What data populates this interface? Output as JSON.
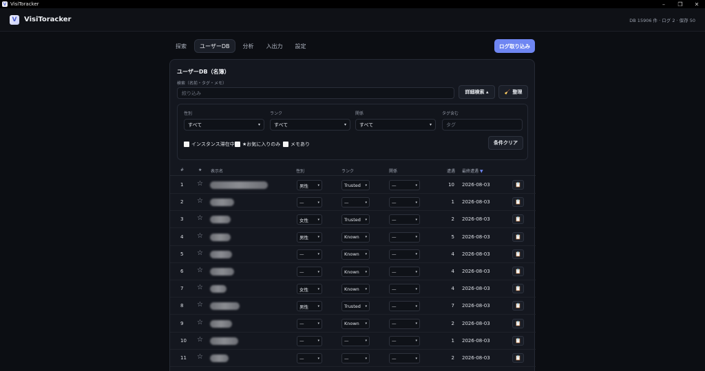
{
  "window": {
    "title": "VisiToracker",
    "controls": [
      "–",
      "❐",
      "✕"
    ]
  },
  "header": {
    "logo_letter": "V",
    "brand": "VisiToracker",
    "stats": "DB 15906 件 · ログ 2 · 保存 50"
  },
  "nav": {
    "tabs": [
      {
        "label": "探索",
        "active": false
      },
      {
        "label": "ユーザーDB",
        "active": true
      },
      {
        "label": "分析",
        "active": false
      },
      {
        "label": "入出力",
        "active": false
      },
      {
        "label": "設定",
        "active": false
      }
    ],
    "import_label": "ログ取り込み"
  },
  "panel": {
    "title": "ユーザーDB（名簿）",
    "search_label": "検索（名前・タグ・メモ）",
    "search_placeholder": "絞り込み",
    "search_value": "",
    "advanced_label": "詳細検索 ▴",
    "tidy_label": "整理",
    "filters": {
      "gender": {
        "label": "性別",
        "value": "すべて"
      },
      "rank": {
        "label": "ランク",
        "value": "すべて"
      },
      "relation": {
        "label": "関係",
        "value": "すべて"
      },
      "tag": {
        "label": "タグ含む",
        "placeholder": "タグ"
      },
      "checks": [
        {
          "label": "インスタンス滞在中",
          "checked": false
        },
        {
          "label": "★お気に入りのみ",
          "checked": false
        },
        {
          "label": "メモあり",
          "checked": false
        }
      ],
      "clear_label": "条件クリア"
    },
    "table": {
      "headers": {
        "index": "#",
        "star": "★",
        "name": "表示名",
        "gender": "性別",
        "rank": "ランク",
        "relation": "関係",
        "encounters": "遭遇",
        "last_seen": "最終遭遇",
        "sort_arrow": "▼"
      },
      "rows": [
        {
          "n": "1",
          "name_blur": 0.62,
          "gender": "男性",
          "rank": "Trusted",
          "relation": "—",
          "count": "10",
          "date": "2026-08-03"
        },
        {
          "n": "2",
          "name_blur": 0.26,
          "gender": "—",
          "rank": "—",
          "relation": "—",
          "count": "1",
          "date": "2026-08-03"
        },
        {
          "n": "3",
          "name_blur": 0.22,
          "gender": "女性",
          "rank": "Trusted",
          "relation": "—",
          "count": "2",
          "date": "2026-08-03"
        },
        {
          "n": "4",
          "name_blur": 0.22,
          "gender": "男性",
          "rank": "Known",
          "relation": "—",
          "count": "5",
          "date": "2026-08-03"
        },
        {
          "n": "5",
          "name_blur": 0.24,
          "gender": "—",
          "rank": "Known",
          "relation": "—",
          "count": "4",
          "date": "2026-08-03"
        },
        {
          "n": "6",
          "name_blur": 0.26,
          "gender": "—",
          "rank": "Known",
          "relation": "—",
          "count": "4",
          "date": "2026-08-03"
        },
        {
          "n": "7",
          "name_blur": 0.18,
          "gender": "女性",
          "rank": "Known",
          "relation": "—",
          "count": "4",
          "date": "2026-08-03"
        },
        {
          "n": "8",
          "name_blur": 0.32,
          "gender": "男性",
          "rank": "Trusted",
          "relation": "—",
          "count": "7",
          "date": "2026-08-03"
        },
        {
          "n": "9",
          "name_blur": 0.24,
          "gender": "—",
          "rank": "Known",
          "relation": "—",
          "count": "2",
          "date": "2026-08-03"
        },
        {
          "n": "10",
          "name_blur": 0.3,
          "gender": "—",
          "rank": "—",
          "relation": "—",
          "count": "1",
          "date": "2026-08-03"
        },
        {
          "n": "11",
          "name_blur": 0.2,
          "gender": "—",
          "rank": "—",
          "relation": "—",
          "count": "2",
          "date": "2026-08-03"
        }
      ]
    }
  },
  "icons": {
    "star": "star-outline-icon",
    "clipboard": "clipboard-icon",
    "brush": "broom-icon"
  },
  "colors": {
    "accent": "#6f86f2",
    "background": "#0c0e13",
    "panel": "#14171f"
  }
}
